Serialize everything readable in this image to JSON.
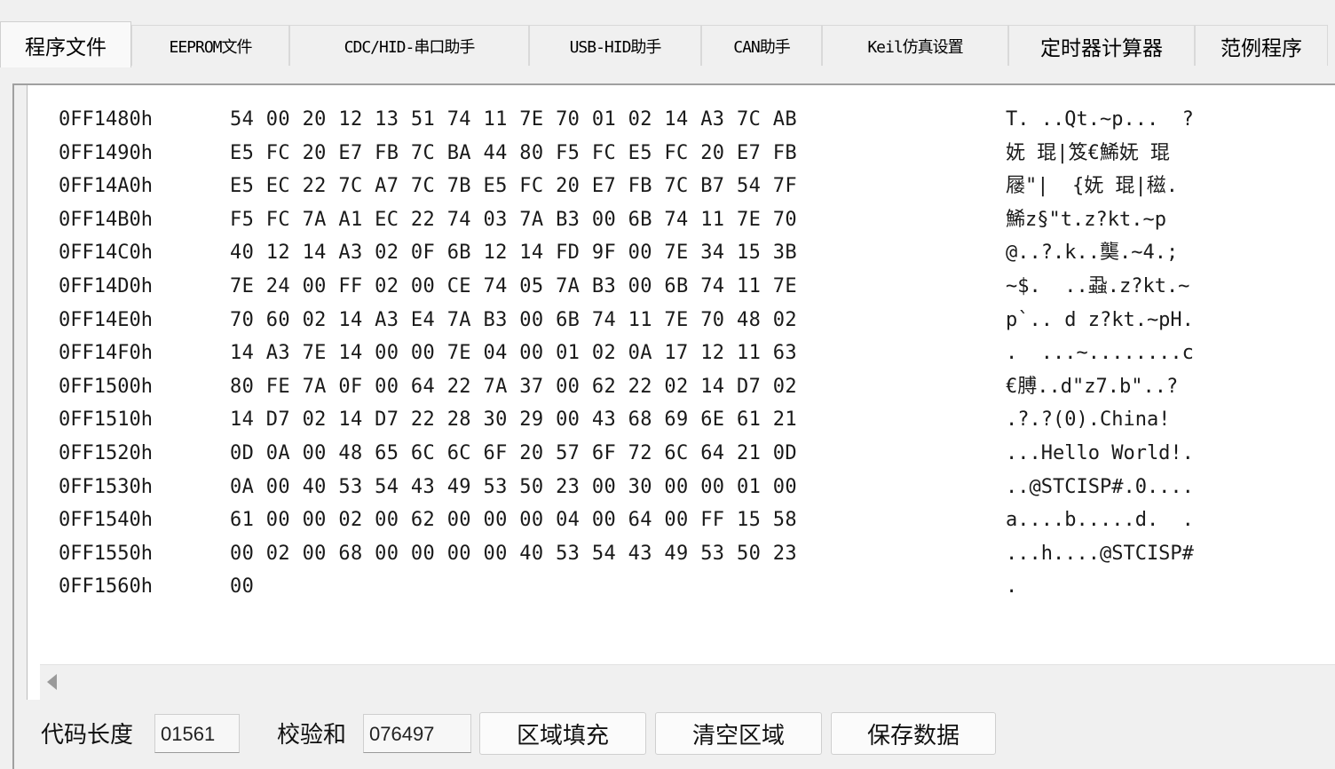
{
  "tabs": [
    {
      "label": "程序文件",
      "active": true
    },
    {
      "label": "EEPROM文件"
    },
    {
      "label": "CDC/HID-串口助手"
    },
    {
      "label": "USB-HID助手"
    },
    {
      "label": "CAN助手"
    },
    {
      "label": "Keil仿真设置"
    },
    {
      "label": "定时器计算器"
    },
    {
      "label": "范例程序"
    }
  ],
  "hex_rows": [
    {
      "addr": "0FF1480h",
      "bytes": "54 00 20 12 13 51 74 11 7E 70 01 02 14 A3 7C AB",
      "ascii": "T. ..Qt.~p...  ?"
    },
    {
      "addr": "0FF1490h",
      "bytes": "E5 FC 20 E7 FB 7C BA 44 80 F5 FC E5 FC 20 E7 FB",
      "ascii": "妩 琨|笈€鯑妩 琨"
    },
    {
      "addr": "0FF14A0h",
      "bytes": "E5 EC 22 7C A7 7C 7B E5 FC 20 E7 FB 7C B7 54 7F",
      "ascii": "屦\"|  {妩 琨|稵."
    },
    {
      "addr": "0FF14B0h",
      "bytes": "F5 FC 7A A1 EC 22 74 03 7A B3 00 6B 74 11 7E 70",
      "ascii": "鯑z§\"t.z?kt.~p"
    },
    {
      "addr": "0FF14C0h",
      "bytes": "40 12 14 A3 02 0F 6B 12 14 FD 9F 00 7E 34 15 3B",
      "ascii": "@..?.k..龑.~4.;"
    },
    {
      "addr": "0FF14D0h",
      "bytes": "7E 24 00 FF 02 00 CE 74 05 7A B3 00 6B 74 11 7E",
      "ascii": "~$.  ..蝨.z?kt.~"
    },
    {
      "addr": "0FF14E0h",
      "bytes": "70 60 02 14 A3 E4 7A B3 00 6B 74 11 7E 70 48 02",
      "ascii": "p`.. d z?kt.~pH."
    },
    {
      "addr": "0FF14F0h",
      "bytes": "14 A3 7E 14 00 00 7E 04 00 01 02 0A 17 12 11 63",
      "ascii": ".  ...~........c"
    },
    {
      "addr": "0FF1500h",
      "bytes": "80 FE 7A 0F 00 64 22 7A 37 00 62 22 02 14 D7 02",
      "ascii": "€膊..d\"z7.b\"..?"
    },
    {
      "addr": "0FF1510h",
      "bytes": "14 D7 02 14 D7 22 28 30 29 00 43 68 69 6E 61 21",
      "ascii": ".?.?(0).China!"
    },
    {
      "addr": "0FF1520h",
      "bytes": "0D 0A 00 48 65 6C 6C 6F 20 57 6F 72 6C 64 21 0D",
      "ascii": "...Hello World!."
    },
    {
      "addr": "0FF1530h",
      "bytes": "0A 00 40 53 54 43 49 53 50 23 00 30 00 00 01 00",
      "ascii": "..@STCISP#.0...."
    },
    {
      "addr": "0FF1540h",
      "bytes": "61 00 00 02 00 62 00 00 00 04 00 64 00 FF 15 58",
      "ascii": "a....b.....d.  ."
    },
    {
      "addr": "0FF1550h",
      "bytes": "00 02 00 68 00 00 00 00 40 53 54 43 49 53 50 23",
      "ascii": "...h....@STCISP#"
    },
    {
      "addr": "0FF1560h",
      "bytes": "00",
      "ascii": "."
    }
  ],
  "footer": {
    "code_length_label": "代码长度",
    "code_length_value": "01561",
    "checksum_label": "校验和",
    "checksum_value": "076497",
    "btn_fill": "区域填充",
    "btn_clear": "清空区域",
    "btn_save": "保存数据"
  }
}
